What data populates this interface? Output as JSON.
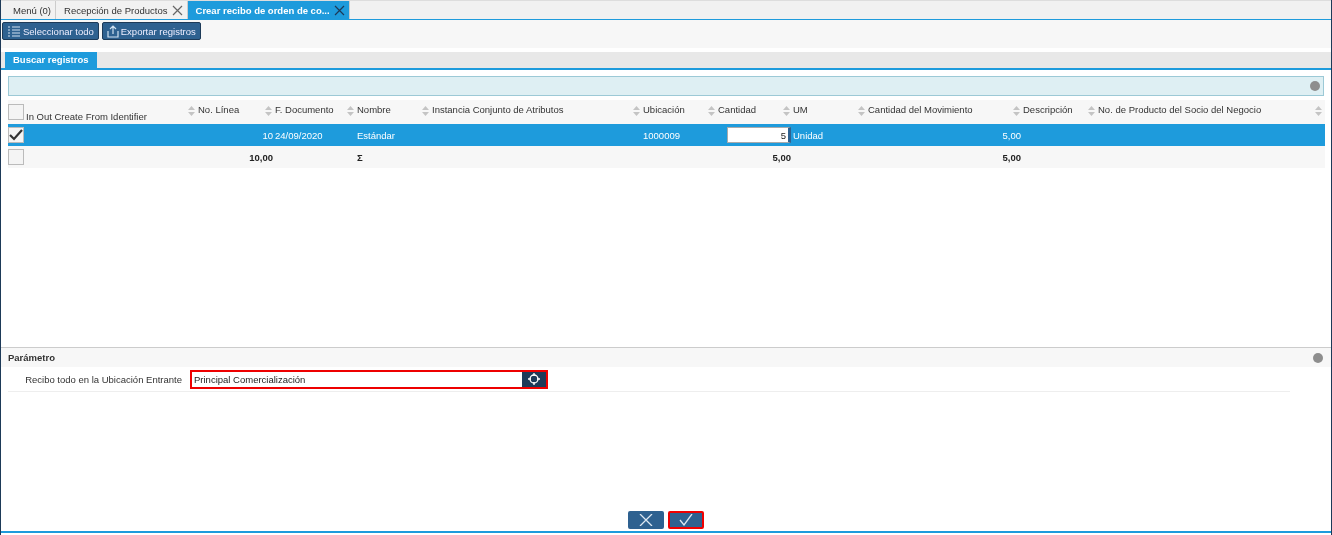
{
  "tabs": [
    {
      "label": "Menú (0)",
      "selected": false,
      "closable": false
    },
    {
      "label": "Recepción de Productos",
      "selected": false,
      "closable": true
    },
    {
      "label": "Crear recibo de orden de co...",
      "selected": true,
      "closable": true
    }
  ],
  "toolbar": [
    {
      "label": "Seleccionar todo",
      "kind": "list"
    },
    {
      "label": "Exportar registros",
      "kind": "export"
    }
  ],
  "panel_tab": {
    "label": "Buscar registros",
    "selected": true
  },
  "table": {
    "all_checked": false,
    "columns": [
      "In Out Create From Identifier",
      "No. Línea",
      "F. Documento",
      "Nombre",
      "Instancia Conjunto de Atributos",
      "Ubicación",
      "Cantidad",
      "UM",
      "Cantidad del Movimiento",
      "Descripción",
      "No. de Producto del Socio del Negocio"
    ],
    "rows": [
      {
        "selected": true,
        "checked": true,
        "cells": [
          "",
          "10",
          "24/09/2020",
          "Estándar",
          "",
          "1000009",
          "5",
          "Unidad",
          "5,00",
          "",
          ""
        ]
      }
    ],
    "summary": {
      "checked": false,
      "cells": [
        "",
        "10,00",
        "",
        "Σ",
        "",
        "",
        "5,00",
        "",
        "5,00",
        "",
        ""
      ]
    }
  },
  "parameters": {
    "title": "Parámetro",
    "fields": [
      {
        "label": "Recibo todo en la Ubicación Entrante",
        "value": "Principal Comercialización",
        "highlighted": true
      }
    ]
  },
  "actions": [
    {
      "kind": "cancel",
      "highlighted": false
    },
    {
      "kind": "ok",
      "highlighted": true
    }
  ]
}
